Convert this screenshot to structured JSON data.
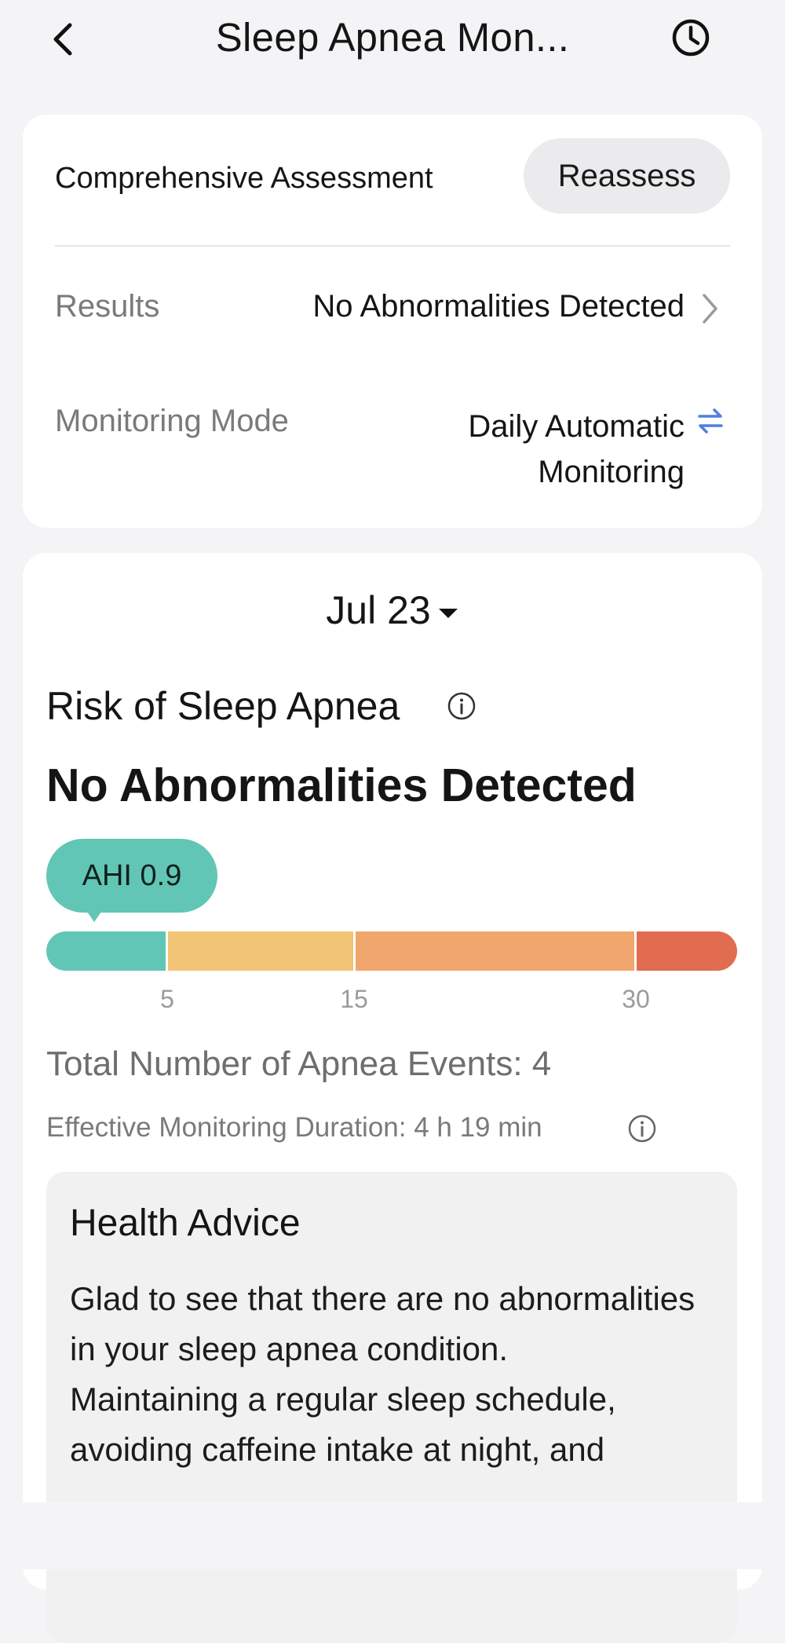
{
  "header": {
    "title": "Sleep Apnea Mon...",
    "back_icon": "chevron-left-icon",
    "history_icon": "clock-icon"
  },
  "assessment": {
    "title": "Comprehensive Assessment",
    "reassess_label": "Reassess",
    "results_label": "Results",
    "results_value": "No Abnormalities Detected",
    "mode_label": "Monitoring Mode",
    "mode_value": "Daily Automatic Monitoring",
    "mode_icon": "switch-arrows-icon"
  },
  "detail": {
    "date": "Jul 23",
    "risk_title": "Risk of Sleep Apnea",
    "risk_result": "No Abnormalities Detected",
    "ahi_label": "AHI 0.9",
    "ahi_value": 0.9,
    "scale": {
      "thresholds": [
        5,
        15,
        30
      ],
      "tick_labels": [
        "5",
        "15",
        "30"
      ],
      "colors": [
        "#61c6b5",
        "#f2c475",
        "#f0a66c",
        "#e26c4f"
      ]
    },
    "events_text": "Total Number of Apnea Events: 4",
    "duration_text": "Effective Monitoring Duration: 4 h 19 min"
  },
  "advice": {
    "title": "Health Advice",
    "paragraph1": "Glad to see that there are no abnormalities in your sleep apnea condition.",
    "paragraph2": "Maintaining a regular sleep schedule, avoiding caffeine intake at night, and"
  },
  "colors": {
    "accent_blue": "#4f7fe0",
    "background": "#f4f4f6"
  }
}
